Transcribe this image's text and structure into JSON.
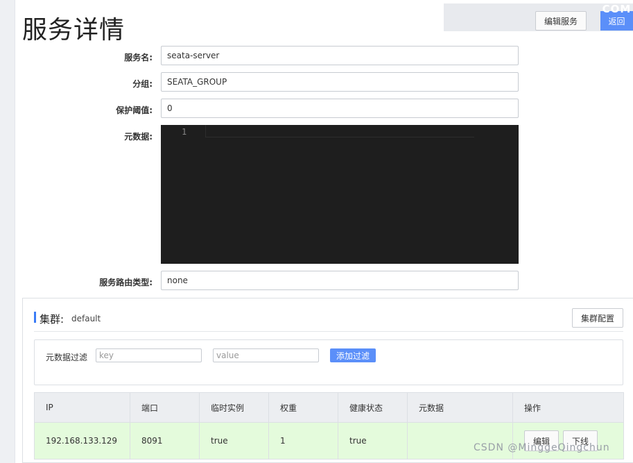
{
  "page": {
    "title": "服务详情"
  },
  "header": {
    "edit_service_label": "编辑服务",
    "back_label": "返回",
    "brand_fragment": "COM"
  },
  "form": {
    "service_name": {
      "label": "服务名:",
      "value": "seata-server"
    },
    "group": {
      "label": "分组:",
      "value": "SEATA_GROUP"
    },
    "protect_threshold": {
      "label": "保护阈值:",
      "value": "0"
    },
    "metadata": {
      "label": "元数据:",
      "line_number": "1"
    },
    "route_type": {
      "label": "服务路由类型:",
      "value": "none"
    }
  },
  "cluster": {
    "title": "集群:",
    "name": "default",
    "config_label": "集群配置",
    "filter": {
      "label": "元数据过滤",
      "key_placeholder": "key",
      "value_placeholder": "value",
      "add_label": "添加过滤"
    },
    "table": {
      "headers": [
        "IP",
        "端口",
        "临时实例",
        "权重",
        "健康状态",
        "元数据",
        "操作"
      ],
      "rows": [
        {
          "ip": "192.168.133.129",
          "port": "8091",
          "ephemeral": "true",
          "weight": "1",
          "healthy": "true",
          "metadata": "",
          "edit_label": "编辑",
          "offline_label": "下线"
        }
      ]
    }
  },
  "watermark": "CSDN @MinggeQingchun",
  "colors": {
    "primary": "#5b8ff9",
    "accent_bar": "#3b7cf6",
    "healthy_row": "#e4fbdc",
    "editor_bg": "#1e1e1e"
  }
}
